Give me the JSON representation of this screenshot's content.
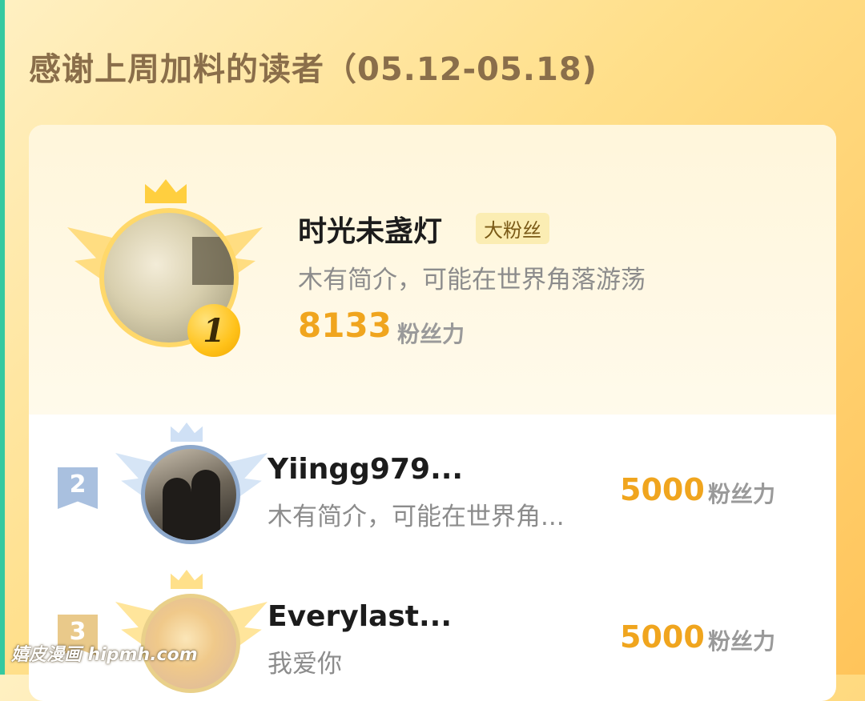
{
  "page_title": "感谢上周加料的读者（05.12-05.18)",
  "top_reader": {
    "rank": "1",
    "name": "时光未盏灯",
    "badge": "大粉丝",
    "bio": "木有简介，可能在世界角落游荡",
    "score": "8133",
    "unit": "粉丝力"
  },
  "readers": [
    {
      "rank": "2",
      "name": "Yiingg979...",
      "bio": "木有简介，可能在世界角...",
      "score": "5000",
      "unit": "粉丝力"
    },
    {
      "rank": "3",
      "name": "Everylast...",
      "bio": "我爱你",
      "score": "5000",
      "unit": "粉丝力"
    }
  ],
  "watermark": "嬉皮漫画 hipmh.com",
  "colors": {
    "accent": "#f0a51e",
    "gold": "#ffc21a",
    "silver": "#a9c0df",
    "bronze": "#e9c98a"
  }
}
